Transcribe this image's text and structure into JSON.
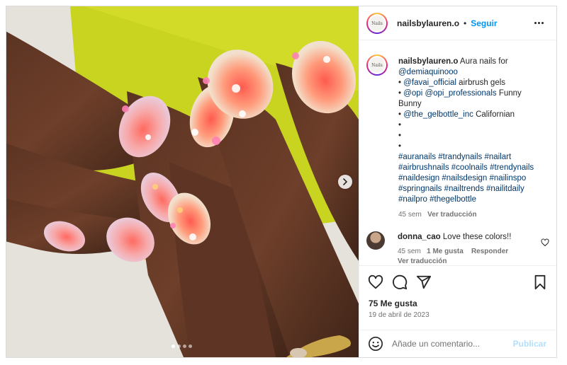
{
  "post": {
    "username": "nailsbylauren.o",
    "separator": "•",
    "follow_label": "Seguir",
    "avatar_text": "Nails",
    "caption": {
      "username": "nailsbylauren.o",
      "intro": " Aura nails for",
      "mention_line": "@demiaquinooo",
      "lines": [
        {
          "bullet": "• ",
          "link": "@favai_official",
          "rest": " airbrush gels"
        },
        {
          "bullet": "• ",
          "link": "@opi @opi_professionals",
          "rest": " Funny"
        },
        {
          "bullet": "",
          "link": "",
          "rest": "Bunny"
        },
        {
          "bullet": "• ",
          "link": "@the_gelbottle_inc",
          "rest": " Californian"
        }
      ],
      "empty_bullets": [
        "•",
        "•",
        "•"
      ],
      "hashtag_lines": [
        "#auranails #trandynails #nailart",
        "#airbrushnails #coolnails #trendynails",
        "#naildesign #nailsdesign #nailinspo",
        "#springnails #nailtrends #nailitdaily",
        "#nailpro #thegelbottle"
      ],
      "age": "45 sem",
      "translate": "Ver traducción"
    },
    "comment": {
      "username": "donna_cao",
      "text": " Love these colors!!",
      "age": "45 sem",
      "likes": "1 Me gusta",
      "reply": "Responder",
      "translate": "Ver traducción"
    },
    "likes_label": "75 Me gusta",
    "date": "19 de abril de 2023",
    "comment_placeholder": "Añade un comentario...",
    "publish_label": "Publicar"
  },
  "carousel": {
    "count": 4,
    "active": 0
  },
  "icons": {
    "more": "more-horizontal-icon",
    "like": "heart-icon",
    "comment": "comment-bubble-icon",
    "share": "paper-plane-icon",
    "save": "bookmark-icon",
    "emoji": "emoji-smile-icon",
    "next": "chevron-right-icon",
    "comment_like": "heart-small-icon"
  },
  "colors": {
    "link": "#00376b",
    "follow": "#0095f6",
    "publish_disabled": "#b2dffc",
    "muted": "#737373"
  }
}
